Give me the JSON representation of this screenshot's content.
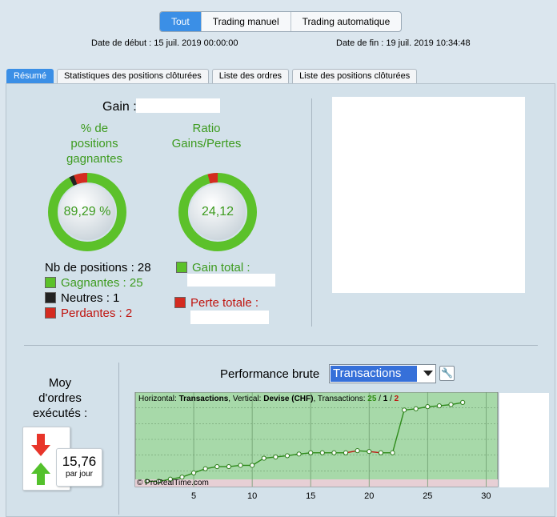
{
  "header": {
    "segments": [
      "Tout",
      "Trading manuel",
      "Trading automatique"
    ],
    "active_segment": 0,
    "start_date": "Date de début :  15 juil. 2019 00:00:00",
    "end_date": "Date de fin :  19 juil. 2019 10:34:48"
  },
  "tabs": [
    "Résumé",
    "Statistiques des positions clôturées",
    "Liste des ordres",
    "Liste des positions clôturées"
  ],
  "summary": {
    "gain_label": "Gain :",
    "pct_title": [
      "% de",
      "positions",
      "gagnantes"
    ],
    "pct_value": "89,29 %",
    "ratio_title": [
      "Ratio",
      "Gains/Pertes"
    ],
    "ratio_value": "24,12",
    "nb_positions": "Nb de positions : 28",
    "winning": "Gagnantes : 25",
    "neutral": "Neutres : 1",
    "losing": "Perdantes : 2",
    "gain_total": "Gain total :",
    "perte_totale": "Perte totale :"
  },
  "orders": {
    "title": [
      "Moy",
      "d'ordres",
      "exécutés :"
    ],
    "value": "15,76",
    "unit": "par jour"
  },
  "performance": {
    "label": "Performance brute",
    "select_value": "Transactions",
    "legend_prefix": "Horizontal:",
    "legend_h": "Transactions",
    "legend_mid": ", Vertical:",
    "legend_v": "Devise (CHF)",
    "legend_tr": ", Transactions:",
    "legend_win": "25",
    "legend_slash1": " / ",
    "legend_neu": "1",
    "legend_slash2": " / ",
    "legend_lose": "2",
    "watermark": "© ProRealTime.com"
  },
  "colors": {
    "accent": "#3b8fe6",
    "win": "#3d9b1f",
    "lose": "#c0140f",
    "neutral": "#333333",
    "chart_bg": "#a7d9a9"
  },
  "chart_data": {
    "type": "line",
    "xlabel": "",
    "ylabel": "",
    "x_ticks": [
      5,
      10,
      15,
      20,
      25,
      30
    ],
    "xlim": [
      0,
      31
    ],
    "x": [
      1,
      2,
      3,
      4,
      5,
      6,
      7,
      8,
      9,
      10,
      11,
      12,
      13,
      14,
      15,
      16,
      17,
      18,
      19,
      20,
      21,
      22,
      23,
      24,
      25,
      26,
      27,
      28
    ],
    "values": [
      0.5,
      0.5,
      1,
      1.5,
      2.5,
      3.5,
      4,
      4,
      4.3,
      4.3,
      6,
      6.3,
      6.6,
      7,
      7.3,
      7.3,
      7.3,
      7.3,
      7.8,
      7.6,
      7.3,
      7.3,
      17.5,
      17.8,
      18.3,
      18.5,
      18.8,
      19.3
    ],
    "losing_segments": [
      [
        18,
        19
      ],
      [
        20,
        21
      ]
    ],
    "ylim": [
      0,
      21
    ]
  }
}
